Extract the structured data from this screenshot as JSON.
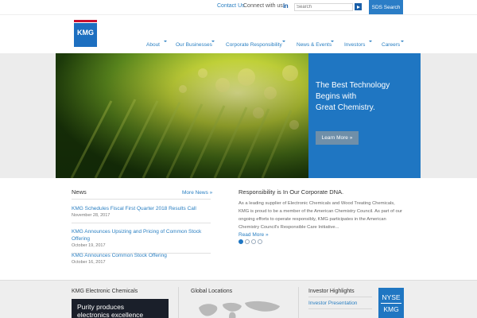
{
  "topbar": {
    "contact_label": "Contact Us",
    "connect_label": "Connect with us:",
    "social_icon": "linkedin-icon",
    "social_text": "in",
    "search_placeholder": "Search",
    "sds_label": "SDS Search"
  },
  "brand": {
    "logo_text": "KMG",
    "accent": "#1f76c2",
    "logo_stripe": "#c8102e"
  },
  "nav": {
    "items": [
      {
        "label": "About"
      },
      {
        "label": "Our Businesses"
      },
      {
        "label": "Corporate Responsibility"
      },
      {
        "label": "News & Events"
      },
      {
        "label": "Investors"
      },
      {
        "label": "Careers"
      }
    ]
  },
  "hero": {
    "headline_line1": "The Best Technology",
    "headline_line2": "Begins with",
    "headline_line3": "Great Chemistry.",
    "cta_label": "Learn More »"
  },
  "news": {
    "title": "News",
    "more_label": "More News »",
    "items": [
      {
        "headline": "KMG Schedules Fiscal First Quarter 2018 Results Call",
        "date": "November 28, 2017"
      },
      {
        "headline": "KMG Announces Upsizing and Pricing of Common Stock Offering",
        "date": "October 19, 2017"
      },
      {
        "headline": "KMG Announces Common Stock Offering",
        "date": "October 16, 2017"
      }
    ]
  },
  "responsibility": {
    "title": "Responsibility is In Our Corporate DNA.",
    "body": "As a leading supplier of Electronic Chemicals and Wood Treating Chemicals, KMG is proud to be a member of the American Chemistry Council. As part of our ongoing efforts to operate responsibly, KMG participates in the American Chemistry Council's Responsible Care Initiative...",
    "more_label": "Read More »",
    "slides_total": 4,
    "active_slide": 1
  },
  "footer": {
    "electronic_title": "KMG Electronic Chemicals",
    "promo_line1": "Purity produces",
    "promo_line2": "electronics excellence",
    "locations_title": "Global Locations",
    "investor_title": "Investor Highlights",
    "investor_link": "Investor Presentation",
    "ticker_exchange": "NYSE",
    "ticker_symbol": "KMG"
  }
}
